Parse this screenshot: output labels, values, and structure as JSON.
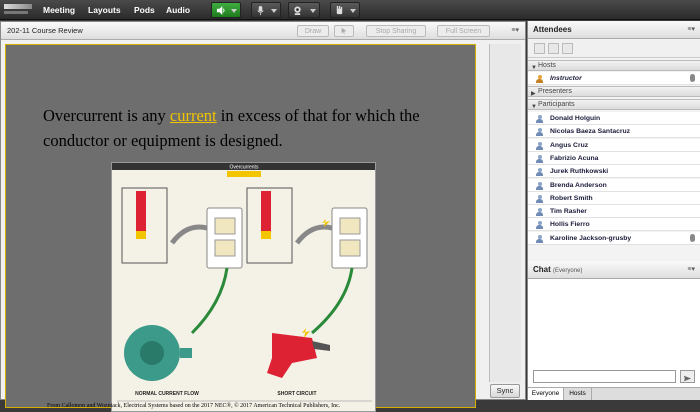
{
  "topbar": {
    "menus": [
      "Meeting",
      "Layouts",
      "Pods",
      "Audio"
    ],
    "icons": [
      "speaker-icon",
      "microphone-icon",
      "webcam-icon",
      "raise-hand-icon"
    ]
  },
  "share_pod": {
    "title": "202-11 Course Review",
    "buttons": [
      "Draw",
      "Stop Sharing",
      "Full Screen"
    ],
    "menu": "≡▾",
    "sync_label": "Sync"
  },
  "slide": {
    "text_before": "Overcurrent is any",
    "highlight": "current",
    "text_after": "in excess of that for which the conductor or equipment is designed.",
    "figure_title": "Overcurrents",
    "figure_labels": [
      "NORMAL CURRENT FLOW",
      "SHORT CIRCUIT"
    ],
    "credit": "From Callomon and Wozniack, Electrical Systems based on the 2017 NEC®, © 2017 American Technical Publishers, Inc."
  },
  "attendees": {
    "title": "Attendees",
    "menu": "≡▾",
    "sections": {
      "hosts": "Hosts",
      "presenters": "Presenters",
      "participants": "Participants"
    },
    "host_name": "Instructor",
    "participants": [
      "Donald Holguin",
      "Nicolas Baeza Santacruz",
      "Angus Cruz",
      "Fabrizio Acuna",
      "Jurek Ruthkowski",
      "Brenda Anderson",
      "Robert Smith",
      "Tim Rasher",
      "Hollis Fierro",
      "Karoline Jackson-grusby"
    ]
  },
  "chat": {
    "title": "Chat",
    "scope": "(Everyone)",
    "menu": "≡▾",
    "tabs": [
      "Everyone",
      "Hosts"
    ]
  }
}
